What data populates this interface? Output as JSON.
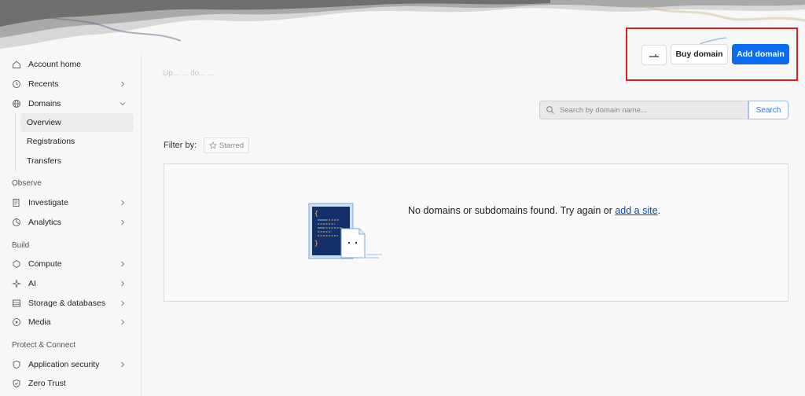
{
  "header": {
    "icon_button": "shortcut-icon",
    "buy_domain": "Buy domain",
    "add_domain": "Add domain",
    "subtitle": "Up... ... do... ..."
  },
  "sidebar": {
    "account_home": "Account home",
    "recents": "Recents",
    "domains": "Domains",
    "domains_sub": [
      "Overview",
      "Registrations",
      "Transfers"
    ],
    "sections": {
      "observe": "Observe",
      "build": "Build",
      "protect": "Protect & Connect"
    },
    "observe_items": [
      "Investigate",
      "Analytics"
    ],
    "build_items": [
      "Compute",
      "AI",
      "Storage & databases",
      "Media"
    ],
    "protect_items": [
      "Application security",
      "Zero Trust"
    ]
  },
  "search": {
    "placeholder": "Search by domain name...",
    "button": "Search"
  },
  "filter": {
    "label": "Filter by:",
    "starred": "Starred"
  },
  "empty_state": {
    "message": "No domains or subdomains found. Try again or ",
    "link": "add a site",
    "suffix": "."
  },
  "colors": {
    "accent": "#0a6cf0",
    "highlight_border": "#e02020",
    "link": "#0a4ba8"
  }
}
